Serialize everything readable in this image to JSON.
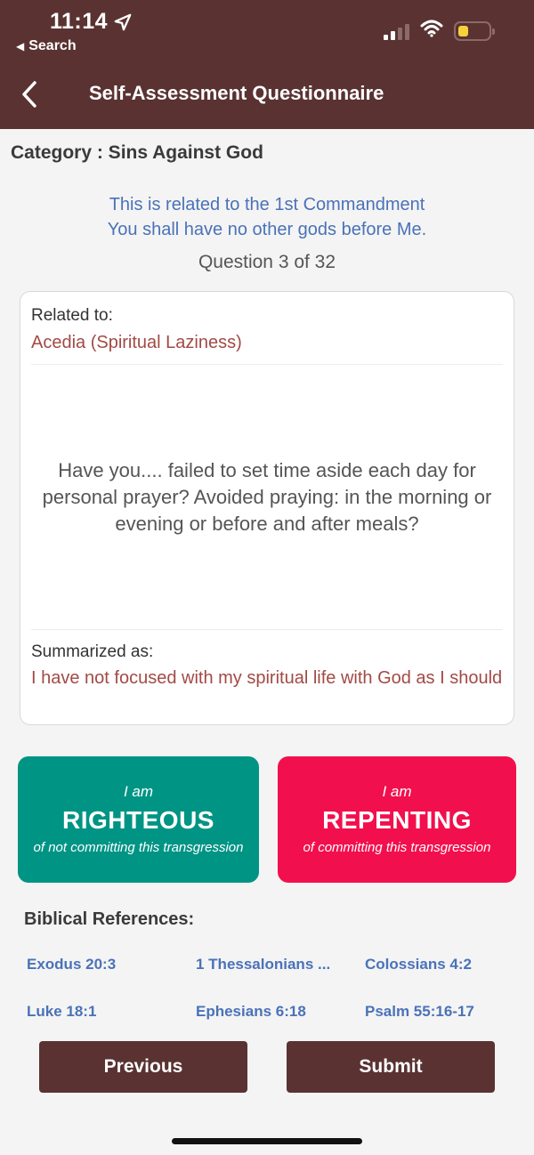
{
  "status_bar": {
    "time": "11:14",
    "back_app": "Search"
  },
  "nav": {
    "title": "Self-Assessment Questionnaire"
  },
  "category_line": "Category : Sins Against God",
  "commandment": {
    "line1": "This is related to the 1st Commandment",
    "line2": "You shall have no other gods before Me."
  },
  "question_counter": "Question 3 of 32",
  "card": {
    "related_label": "Related to:",
    "related_value": "Acedia (Spiritual Laziness)",
    "question": "Have you.... failed to set time aside each day for personal prayer? Avoided praying: in the morning or evening or before and after meals?",
    "summary_label": "Summarized as:",
    "summary_value": "I have not focused with my spiritual life with God as I should"
  },
  "choices": {
    "righteous": {
      "prefix": "I am",
      "title": "RIGHTEOUS",
      "subtitle": "of not committing this transgression"
    },
    "repenting": {
      "prefix": "I am",
      "title": "REPENTING",
      "subtitle": "of committing this transgression"
    }
  },
  "references": {
    "title": "Biblical References:",
    "items": [
      "Exodus 20:3",
      "1 Thessalonians ...",
      "Colossians 4:2",
      "Luke 18:1",
      "Ephesians 6:18",
      "Psalm 55:16-17"
    ]
  },
  "buttons": {
    "previous": "Previous",
    "submit": "Submit"
  },
  "colors": {
    "header": "#5a3232",
    "righteous": "#009485",
    "repenting": "#f20f4d",
    "link": "#4a72b8",
    "accent_text": "#a24a45"
  }
}
